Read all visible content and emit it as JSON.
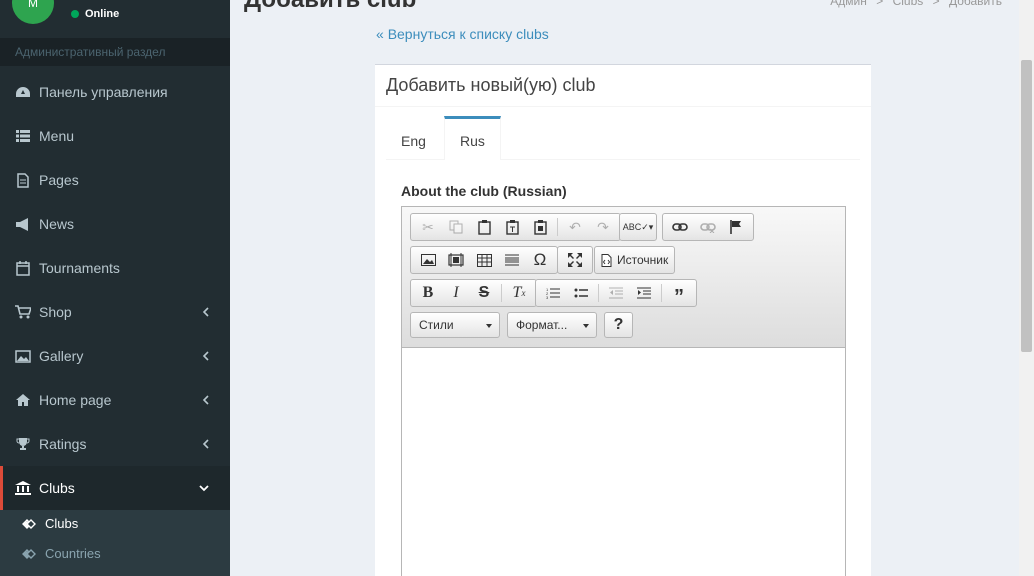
{
  "user": {
    "avatar_letter": "M",
    "status": "Online"
  },
  "sidebar": {
    "section_header": "Административный раздел",
    "items": [
      {
        "label": "Панель управления",
        "icon": "dashboard-icon"
      },
      {
        "label": "Menu",
        "icon": "list-icon"
      },
      {
        "label": "Pages",
        "icon": "file-icon"
      },
      {
        "label": "News",
        "icon": "bullhorn-icon"
      },
      {
        "label": "Tournaments",
        "icon": "calendar-icon"
      },
      {
        "label": "Shop",
        "icon": "cart-icon"
      },
      {
        "label": "Gallery",
        "icon": "image-icon"
      },
      {
        "label": "Home page",
        "icon": "home-icon"
      },
      {
        "label": "Ratings",
        "icon": "trophy-icon"
      },
      {
        "label": "Clubs",
        "icon": "institution-icon"
      }
    ],
    "submenu": [
      {
        "label": "Clubs",
        "icon": "diamond-icon"
      },
      {
        "label": "Countries",
        "icon": "diamond-icon"
      }
    ]
  },
  "page": {
    "title": "Добавить club",
    "breadcrumb": [
      "Админ",
      "Clubs",
      "Добавить"
    ],
    "back_link": "Вернуться к списку clubs",
    "box_title": "Добавить новый(ую) club",
    "tabs": [
      "Eng",
      "Rus"
    ],
    "field_label": "About the club (Russian)"
  },
  "editor": {
    "source_label": "Источник",
    "styles_label": "Стили",
    "format_label": "Формат...",
    "help_label": "?"
  },
  "colors": {
    "sidebar_bg": "#222d32",
    "accent": "#3c8dbc",
    "active_border": "#dd4b39",
    "online": "#00a65a"
  }
}
